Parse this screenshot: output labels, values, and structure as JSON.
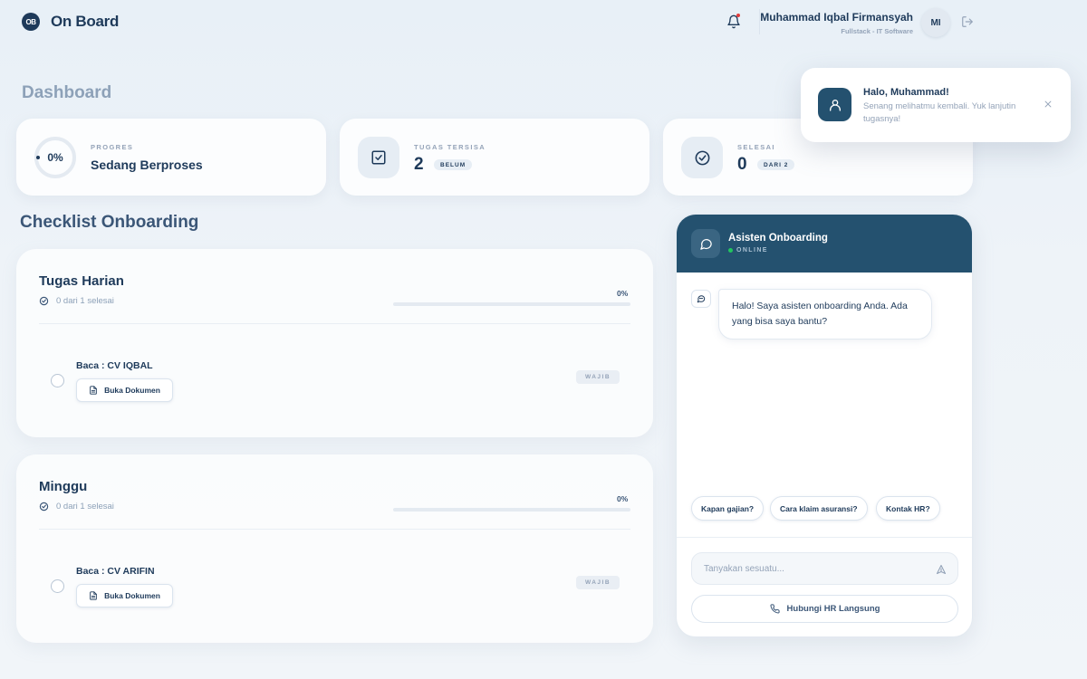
{
  "app": {
    "logo_mark": "OB",
    "logo_text": "On Board"
  },
  "user": {
    "name": "Muhammad Iqbal Firmansyah",
    "role": "Fullstack - IT Software",
    "initials": "MI"
  },
  "page": {
    "title": "Dashboard"
  },
  "stats": {
    "progress": {
      "label": "PROGRES",
      "value": "0%",
      "status": "Sedang Berproses"
    },
    "remaining": {
      "label": "TUGAS TERSISA",
      "count": "2",
      "badge": "BELUM"
    },
    "done": {
      "label": "SELESAI",
      "count": "0",
      "badge": "DARI 2"
    }
  },
  "checklist": {
    "title": "Checklist Onboarding",
    "groups": [
      {
        "title": "Tugas Harian",
        "summary": "0 dari 1 selesai",
        "percent": "0%",
        "progress_fraction": 0,
        "task": "Baca : CV IQBAL",
        "doc_button": "Buka Dokumen",
        "badge": "WAJIB"
      },
      {
        "title": "Minggu",
        "summary": "0 dari 1 selesai",
        "percent": "0%",
        "progress_fraction": 0,
        "task": "Baca : CV ARIFIN",
        "doc_button": "Buka Dokumen",
        "badge": "WAJIB"
      }
    ]
  },
  "chat": {
    "title": "Asisten Onboarding",
    "status": "ONLINE",
    "greeting": "Halo! Saya asisten onboarding Anda. Ada yang bisa saya bantu?",
    "quick_replies": [
      "Kapan gajian?",
      "Cara klaim asuransi?",
      "Kontak HR?"
    ],
    "input_placeholder": "Tanyakan sesuatu...",
    "hr_button": "Hubungi HR Langsung"
  },
  "toast": {
    "title": "Halo, Muhammad!",
    "message": "Senang melihatmu kembali. Yuk lanjutin tugasnya!"
  },
  "colors": {
    "primary": "#1e3a5a",
    "chat_header": "#24516f",
    "notification_dot": "#e23b3b",
    "online": "#22c55e",
    "muted": "#94a3b8"
  }
}
